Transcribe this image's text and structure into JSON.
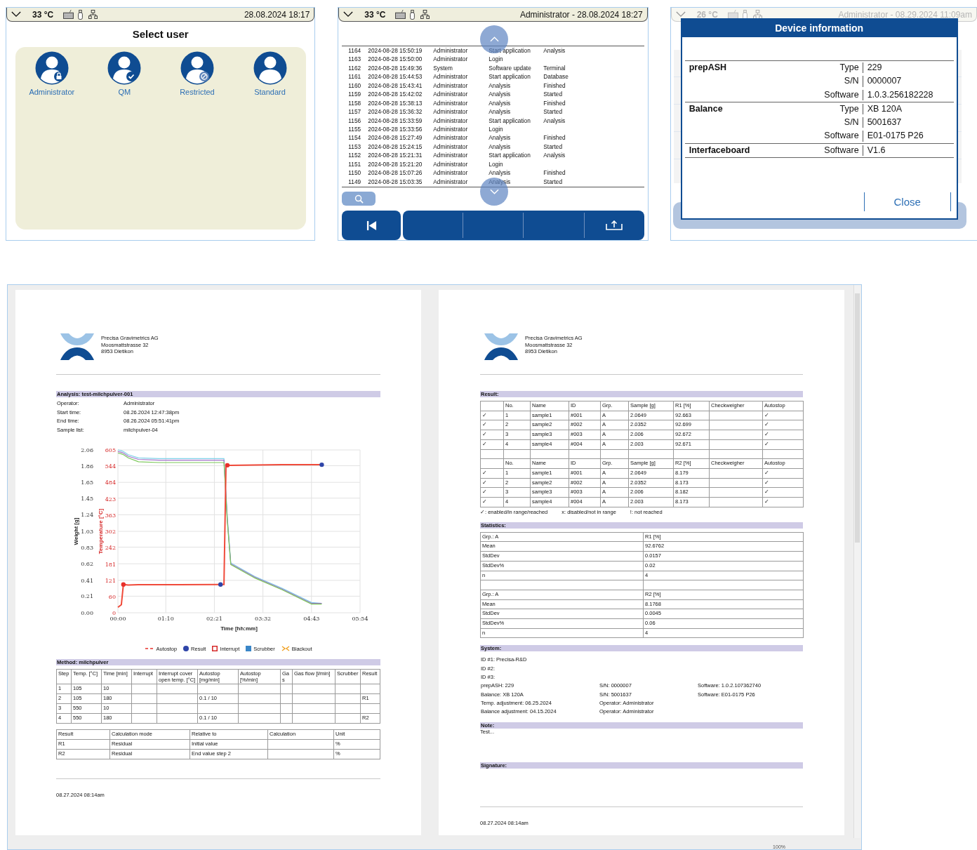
{
  "user_select": {
    "status_bar": {
      "temperature": "33 °C",
      "datetime": "28.08.2024 18:17"
    },
    "title": "Select user",
    "users": [
      {
        "name": "Administrator",
        "kind": "lock"
      },
      {
        "name": "QM",
        "kind": "check"
      },
      {
        "name": "Restricted",
        "kind": "blocked"
      },
      {
        "name": "Standard",
        "kind": "plain"
      }
    ]
  },
  "event_log": {
    "status_bar": {
      "temperature": "33 °C",
      "datetime": "Administrator - 28.08.2024 18:27"
    },
    "rows": [
      {
        "number": "1164",
        "timestamp": "2024-08-28 15:50:19",
        "user": "Administrator",
        "event": "Start application",
        "detail": "Analysis"
      },
      {
        "number": "1163",
        "timestamp": "2024-08-28 15:50:00",
        "user": "Administrator",
        "event": "Login"
      },
      {
        "number": "1162",
        "timestamp": "2024-08-28 15:49:36",
        "user": "System",
        "event": "Software update",
        "detail": "Terminal"
      },
      {
        "number": "1161",
        "timestamp": "2024-08-28 15:44:53",
        "user": "Administrator",
        "event": "Start application",
        "detail": "Database"
      },
      {
        "number": "1160",
        "timestamp": "2024-08-28 15:43:41",
        "user": "Administrator",
        "event": "Analysis",
        "detail": "Finished"
      },
      {
        "number": "1159",
        "timestamp": "2024-08-28 15:42:02",
        "user": "Administrator",
        "event": "Analysis",
        "detail": "Started"
      },
      {
        "number": "1158",
        "timestamp": "2024-08-28 15:38:13",
        "user": "Administrator",
        "event": "Analysis",
        "detail": "Finished"
      },
      {
        "number": "1157",
        "timestamp": "2024-08-28 15:36:32",
        "user": "Administrator",
        "event": "Analysis",
        "detail": "Started"
      },
      {
        "number": "1156",
        "timestamp": "2024-08-28 15:33:59",
        "user": "Administrator",
        "event": "Start application",
        "detail": "Analysis"
      },
      {
        "number": "1155",
        "timestamp": "2024-08-28 15:33:56",
        "user": "Administrator",
        "event": "Login"
      },
      {
        "number": "1154",
        "timestamp": "2024-08-28 15:27:49",
        "user": "Administrator",
        "event": "Analysis",
        "detail": "Finished"
      },
      {
        "number": "1153",
        "timestamp": "2024-08-28 15:24:15",
        "user": "Administrator",
        "event": "Analysis",
        "detail": "Started"
      },
      {
        "number": "1152",
        "timestamp": "2024-08-28 15:21:31",
        "user": "Administrator",
        "event": "Start application",
        "detail": "Analysis"
      },
      {
        "number": "1151",
        "timestamp": "2024-08-28 15:21:20",
        "user": "Administrator",
        "event": "Login"
      },
      {
        "number": "1150",
        "timestamp": "2024-08-28 15:07:26",
        "user": "Administrator",
        "event": "Analysis",
        "detail": "Finished"
      },
      {
        "number": "1149",
        "timestamp": "2024-08-28 15:03:35",
        "user": "Administrator",
        "event": "Analysis",
        "detail": "Started"
      }
    ]
  },
  "device_info": {
    "status_bar": {
      "temperature": "26 °C",
      "datetime": "Administrator - 08.29.2024 11:09am"
    },
    "dialog": {
      "title": "Device information",
      "groups": [
        {
          "name": "prepASH",
          "fields": [
            {
              "label": "Type",
              "value": "229"
            },
            {
              "label": "S/N",
              "value": "0000007"
            },
            {
              "label": "Software",
              "value": "1.0.3.256182228"
            }
          ]
        },
        {
          "name": "Balance",
          "fields": [
            {
              "label": "Type",
              "value": "XB 120A"
            },
            {
              "label": "S/N",
              "value": "5001637"
            },
            {
              "label": "Software",
              "value": "E01-0175  P26"
            }
          ]
        },
        {
          "name": "Interfaceboard",
          "fields": [
            {
              "label": "Software",
              "value": "V1.6"
            }
          ]
        }
      ],
      "close_button": "Close"
    }
  },
  "report_viewer": {
    "zoom": "100%",
    "analysis_page": {
      "company": [
        "Precisa Gravimetrics AG",
        "Moosmattstrasse 32",
        "8953 Dietikon"
      ],
      "heading": "Analysis: test-milchpulver-001",
      "info": [
        {
          "label": "Operator:",
          "value": "Administrator"
        },
        {
          "label": "Start time:",
          "value": "08.26.2024 12:47:38pm"
        },
        {
          "label": "End time:",
          "value": "08.26.2024 05:51:41pm"
        },
        {
          "label": "Sample list:",
          "value": "milchpulver-04"
        }
      ],
      "chart_data": {
        "type": "line",
        "xlabel": "Time [hh:mm]",
        "ylabel": "Weight [g]",
        "y2label": "Temperature [°C]",
        "grid": true,
        "x": [
          0,
          5,
          8,
          15,
          30,
          60,
          150,
          155,
          158,
          160,
          165,
          200,
          240,
          283,
          298
        ],
        "xlim": [
          0,
          354
        ],
        "ylim": [
          0,
          2.06
        ],
        "y2lim": [
          0,
          605
        ],
        "xticks": [
          {
            "value": 0,
            "label": "00:00"
          },
          {
            "value": 70,
            "label": "01:10"
          },
          {
            "value": 141,
            "label": "02:21"
          },
          {
            "value": 212,
            "label": "03:32"
          },
          {
            "value": 283,
            "label": "04:43"
          },
          {
            "value": 354,
            "label": "05:54"
          }
        ],
        "yticks": [
          {
            "value": 0,
            "label": "0.00"
          },
          {
            "value": 0.21,
            "label": "0.21"
          },
          {
            "value": 0.41,
            "label": "0.41"
          },
          {
            "value": 0.62,
            "label": "0.62"
          },
          {
            "value": 0.83,
            "label": "0.83"
          },
          {
            "value": 1.03,
            "label": "1.03"
          },
          {
            "value": 1.24,
            "label": "1.24"
          },
          {
            "value": 1.45,
            "label": "1.45"
          },
          {
            "value": 1.65,
            "label": "1.65"
          },
          {
            "value": 1.86,
            "label": "1.86"
          },
          {
            "value": 2.06,
            "label": "2.06"
          }
        ],
        "y2ticks": [
          0,
          60,
          121,
          181,
          242,
          302,
          363,
          423,
          484,
          544,
          605
        ],
        "series": [
          {
            "color": "#7fd0e8",
            "values": [
              2.06,
              2.05,
              2.04,
              2.0,
              1.96,
              1.95,
              1.95,
              1.95,
              null,
              1.2,
              0.63,
              0.46,
              0.31,
              0.13,
              0.12
            ]
          },
          {
            "color": "#a070c8",
            "values": [
              2.04,
              2.03,
              2.02,
              1.98,
              1.94,
              1.93,
              1.93,
              1.93,
              1.48,
              1.18,
              0.62,
              0.45,
              0.3,
              0.12,
              0.12
            ]
          },
          {
            "color": "#7cc85a",
            "values": [
              2.02,
              2.01,
              2.0,
              1.96,
              1.91,
              1.9,
              1.9,
              1.9,
              1.45,
              1.15,
              0.61,
              0.44,
              0.29,
              0.11,
              0.11
            ]
          },
          {
            "color": "#f04a3a",
            "axis": "y2",
            "values": [
              20,
              30,
              105,
              103,
              104,
              104,
              105,
              105,
              550,
              548,
              548,
              549,
              550,
              550,
              550
            ]
          },
          {
            "color": "#e8302a",
            "axis": "y2",
            "type": "scatter",
            "values": [
              null,
              null,
              105,
              null,
              null,
              null,
              null,
              null,
              null,
              548,
              null,
              null,
              null,
              null,
              null
            ]
          },
          {
            "color": "#2f45a8",
            "axis": "y2",
            "type": "scatter",
            "values": [
              null,
              null,
              null,
              null,
              null,
              null,
              105,
              null,
              null,
              null,
              null,
              null,
              null,
              null,
              550
            ]
          }
        ]
      },
      "legend": [
        {
          "label": "Autostop",
          "kind": "dash"
        },
        {
          "label": "Result",
          "kind": "dot"
        },
        {
          "label": "Interrupt",
          "kind": "outline-square"
        },
        {
          "label": "Scrubber",
          "kind": "square"
        },
        {
          "label": "Blackout",
          "kind": "arrows"
        }
      ],
      "method": {
        "heading": "Method: milchpulver",
        "columns": [
          "Step",
          "Temp. [°C]",
          "Time [min]",
          "Interrupt",
          "Interrupt cover open temp. [°C]",
          "Autostop [mg/min]",
          "Autostop [%/min]",
          "Gas",
          "Gas flow [l/min]",
          "Scrubber",
          "Result"
        ],
        "rows": [
          [
            "1",
            "105",
            "10",
            null,
            null,
            null,
            null,
            null,
            null,
            null,
            null
          ],
          [
            "2",
            "105",
            "180",
            null,
            null,
            "0.1 / 10",
            null,
            null,
            null,
            null,
            "R1"
          ],
          [
            "3",
            "550",
            "10",
            null,
            null,
            null,
            null,
            null,
            null,
            null,
            null
          ],
          [
            "4",
            "550",
            "180",
            null,
            null,
            "0.1 / 10",
            null,
            null,
            null,
            null,
            "R2"
          ]
        ]
      },
      "results": {
        "columns": [
          "Result",
          "Calculation mode",
          "Relative to",
          "Calculation",
          "Unit"
        ],
        "rows": [
          [
            "R1",
            "Residual",
            "Initial value",
            null,
            "%"
          ],
          [
            "R2",
            "Residual",
            "End value step 2",
            null,
            "%"
          ]
        ]
      },
      "footer": "08.27.2024 08:14am"
    },
    "result_page": {
      "company": [
        "Precisa Gravimetrics AG",
        "Moosmattstrasse 32",
        "8953 Dietikon"
      ],
      "result_heading": "Result:",
      "result_blocks": [
        {
          "columns": [
            null,
            "No.",
            "Name",
            "ID",
            "Grp.",
            "Sample [g]",
            "R1 [%]",
            "Checkweigher",
            "Autostop"
          ],
          "rows": [
            [
              "✓",
              "1",
              "sample1",
              "#001",
              "A",
              "2.0649",
              "92.663",
              null,
              "✓"
            ],
            [
              "✓",
              "2",
              "sample2",
              "#002",
              "A",
              "2.0352",
              "92.699",
              null,
              "✓"
            ],
            [
              "✓",
              "3",
              "sample3",
              "#003",
              "A",
              "2.006",
              "92.672",
              null,
              "✓"
            ],
            [
              "✓",
              "4",
              "sample4",
              "#004",
              "A",
              "2.003",
              "92.671",
              null,
              "✓"
            ]
          ]
        },
        {
          "columns": [
            null,
            "No.",
            "Name",
            "ID",
            "Grp.",
            "Sample [g]",
            "R2 [%]",
            "Checkweigher",
            "Autostop"
          ],
          "rows": [
            [
              "✓",
              "1",
              "sample1",
              "#001",
              "A",
              "2.0649",
              "8.179",
              null,
              "✓"
            ],
            [
              "✓",
              "2",
              "sample2",
              "#002",
              "A",
              "2.0352",
              "8.173",
              null,
              "✓"
            ],
            [
              "✓",
              "3",
              "sample3",
              "#003",
              "A",
              "2.006",
              "8.182",
              null,
              "✓"
            ],
            [
              "✓",
              "4",
              "sample4",
              "#004",
              "A",
              "2.003",
              "8.173",
              null,
              "✓"
            ]
          ]
        }
      ],
      "legend": [
        "✓: enabled/in range/reached",
        "x: disabled/not in range",
        "!: not reached"
      ],
      "statistics_heading": "Statistics:",
      "statistics_blocks": [
        [
          [
            "Grp.: A",
            "R1 [%]"
          ],
          [
            "Mean",
            "92.6762"
          ],
          [
            "StdDev",
            "0.0157"
          ],
          [
            "StdDev%",
            "0.02"
          ],
          [
            "n",
            "4"
          ]
        ],
        [
          [
            "Grp.: A",
            "R2 [%]"
          ],
          [
            "Mean",
            "8.1768"
          ],
          [
            "StdDev",
            "0.0045"
          ],
          [
            "StdDev%",
            "0.06"
          ],
          [
            "n",
            "4"
          ]
        ]
      ],
      "system_heading": "System:",
      "system_ids": [
        "ID #1: Precisa-R&D",
        "ID #2:",
        "ID #3:"
      ],
      "system_rows": [
        [
          "prepASH: 229",
          "S/N: 0000007",
          "Software: 1.0.2.107362740"
        ],
        [
          "Balance: XB 120A",
          "S/N: 5001637",
          "Software: E01-0175 P26"
        ],
        [
          "Temp. adjustment: 06.25.2024",
          "Operator: Administrator",
          null
        ],
        [
          "Balance adjustment: 04.15.2024",
          "Operator: Administrator",
          null
        ]
      ],
      "note_heading": "Note:",
      "note": "Test...",
      "signature_heading": "Signature:",
      "footer": "08.27.2024 08:14am"
    }
  }
}
